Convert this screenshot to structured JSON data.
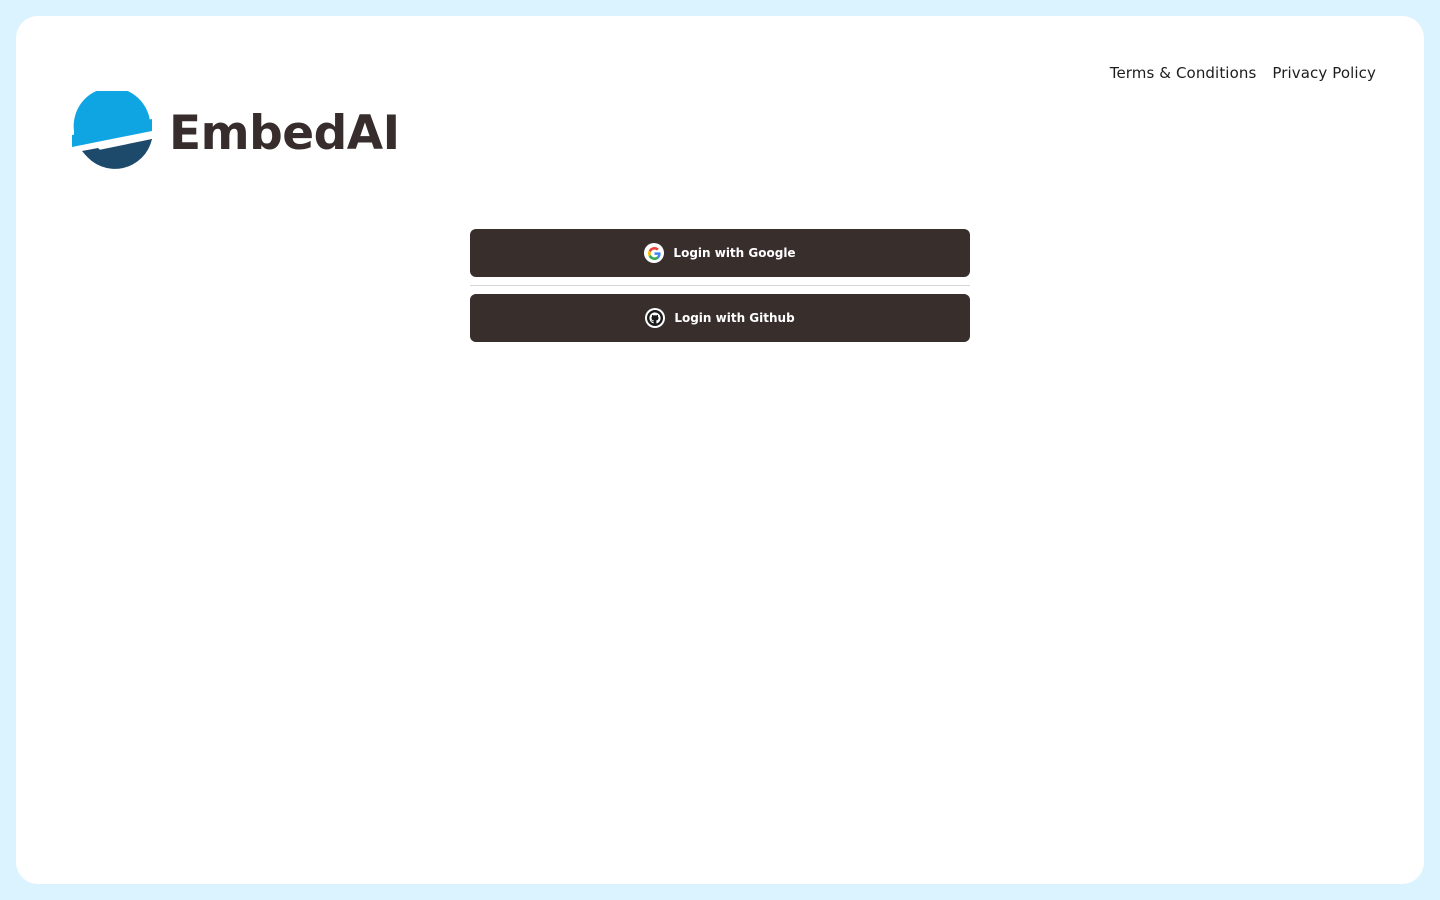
{
  "nav": {
    "terms_label": "Terms & Conditions",
    "privacy_label": "Privacy Policy"
  },
  "brand": {
    "name": "EmbedAI",
    "logo_colors": {
      "top": "#0ea5e2",
      "bottom": "#1d4a6b"
    }
  },
  "login": {
    "google_label": "Login with Google",
    "github_label": "Login with Github",
    "google_icon": "google-icon",
    "github_icon": "github-icon"
  },
  "colors": {
    "background": "#daf3fe",
    "card": "#ffffff",
    "button": "#382f2d",
    "text_dark": "#362d2c"
  }
}
